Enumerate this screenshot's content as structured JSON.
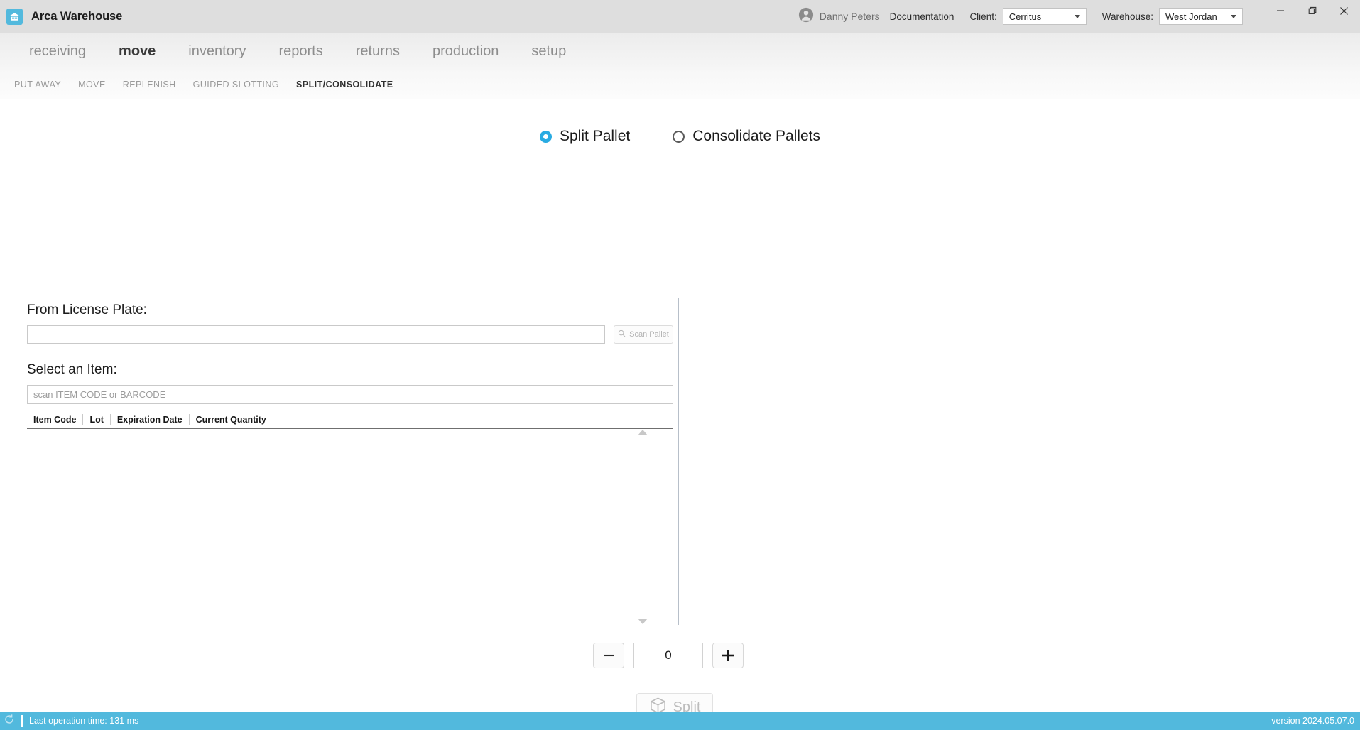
{
  "titlebar": {
    "app_title": "Arca Warehouse",
    "app_icon": "warehouse-building-icon",
    "user_name": "Danny Peters",
    "documentation_link": "Documentation",
    "client_label": "Client:",
    "client_value": "Cerritus",
    "warehouse_label": "Warehouse:",
    "warehouse_value": "West Jordan",
    "minimize_icon": "minimize-icon",
    "maximize_icon": "maximize-icon",
    "close_icon": "close-icon",
    "accent_color": "#52b9dd"
  },
  "mainnav": {
    "items": [
      {
        "label": "receiving",
        "active": false
      },
      {
        "label": "move",
        "active": true
      },
      {
        "label": "inventory",
        "active": false
      },
      {
        "label": "reports",
        "active": false
      },
      {
        "label": "returns",
        "active": false
      },
      {
        "label": "production",
        "active": false
      },
      {
        "label": "setup",
        "active": false
      }
    ]
  },
  "subnav": {
    "items": [
      {
        "label": "PUT AWAY",
        "active": false
      },
      {
        "label": "MOVE",
        "active": false
      },
      {
        "label": "REPLENISH",
        "active": false
      },
      {
        "label": "GUIDED SLOTTING",
        "active": false
      },
      {
        "label": "SPLIT/CONSOLIDATE",
        "active": true
      }
    ]
  },
  "mode": {
    "split_label": "Split Pallet",
    "split_selected": true,
    "consolidate_label": "Consolidate Pallets",
    "consolidate_selected": false,
    "selected_color": "#29abe2"
  },
  "form": {
    "license_plate_label": "From License Plate:",
    "license_plate_value": "",
    "license_plate_placeholder": "",
    "scan_button_label": "Scan Pallet",
    "scan_button_icon": "search-icon",
    "select_item_label": "Select an Item:",
    "item_search_value": "",
    "item_search_placeholder": "scan ITEM CODE or BARCODE"
  },
  "grid": {
    "columns": [
      "Item Code",
      "Lot",
      "Expiration Date",
      "Current Quantity"
    ],
    "rows": [],
    "scroll_up_icon": "scroll-up-arrow-icon",
    "scroll_down_icon": "scroll-down-arrow-icon"
  },
  "stepper": {
    "decrement_icon": "minus-icon",
    "increment_icon": "plus-icon",
    "quantity_value": "0"
  },
  "action": {
    "split_label": "Split",
    "split_icon": "package-box-icon",
    "enabled": false
  },
  "statusbar": {
    "refresh_icon": "refresh-icon",
    "last_operation_text": "Last operation time:  131 ms",
    "version_text": "version 2024.05.07.0"
  }
}
